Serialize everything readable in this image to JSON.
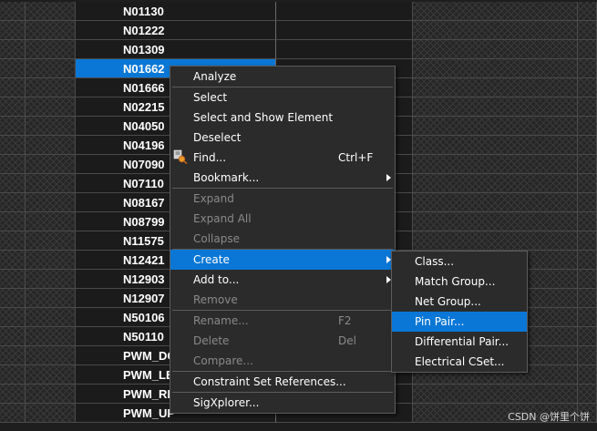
{
  "net_rows": [
    "N01130",
    "N01222",
    "N01309",
    "N01662",
    "N01666",
    "N02215",
    "N04050",
    "N04196",
    "N07090",
    "N07110",
    "N08167",
    "N08799",
    "N11575",
    "N12421",
    "N12903",
    "N12907",
    "N50106",
    "N50110",
    "PWM_DO",
    "PWM_LE",
    "PWM_RI",
    "PWM_UP"
  ],
  "selected_row": "N01662",
  "context_menu": {
    "analyze": "Analyze",
    "select": "Select",
    "select_show": "Select and Show Element",
    "deselect": "Deselect",
    "find": "Find...",
    "find_shortcut": "Ctrl+F",
    "bookmark": "Bookmark...",
    "expand": "Expand",
    "expand_all": "Expand All",
    "collapse": "Collapse",
    "create": "Create",
    "add_to": "Add to...",
    "remove": "Remove",
    "rename": "Rename...",
    "rename_shortcut": "F2",
    "delete": "Delete",
    "delete_shortcut": "Del",
    "compare": "Compare...",
    "constraint_set_references": "Constraint Set References...",
    "sigxplorer": "SigXplorer..."
  },
  "create_submenu": {
    "class": "Class...",
    "match_group": "Match Group...",
    "net_group": "Net Group...",
    "pin_pair": "Pin Pair...",
    "differential_pair": "Differential Pair...",
    "electrical_cset": "Electrical CSet..."
  },
  "highlighted_submenu_item": "Pin Pair...",
  "watermark": "CSDN @饼里个饼",
  "colors": {
    "selection": "#0a77d6",
    "menu_bg": "#2b2b2b",
    "disabled_text": "#8a8a8a"
  }
}
